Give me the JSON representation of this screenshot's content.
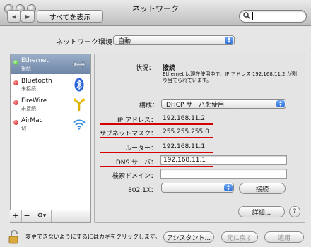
{
  "window": {
    "title": "ネットワーク"
  },
  "toolbar": {
    "back": "◀",
    "forward": "▶",
    "show_all": "すべてを表示",
    "search_value": ""
  },
  "location": {
    "label": "ネットワーク環境：",
    "value": "自動"
  },
  "services": [
    {
      "name": "Ethernet",
      "status": "接続",
      "state": "green",
      "icon": "ethernet-icon",
      "selected": true
    },
    {
      "name": "Bluetooth",
      "status": "未接続",
      "state": "red",
      "icon": "bluetooth-icon"
    },
    {
      "name": "FireWire",
      "status": "未接続",
      "state": "red",
      "icon": "firewire-icon"
    },
    {
      "name": "AirMac",
      "status": "切",
      "state": "red",
      "icon": "wifi-icon"
    }
  ],
  "sidebar_buttons": {
    "add": "+",
    "remove": "−",
    "gear": "⚙▾"
  },
  "details": {
    "status_label": "状況：",
    "status_value": "接続",
    "status_desc": "Ethernet は現在使用中で、IP アドレス 192.168.11.2 が割り当てられています。",
    "config_label": "構成：",
    "config_value": "DHCP サーバを使用",
    "ip_label": "IP アドレス：",
    "ip_value": "192.168.11.2",
    "subnet_label": "サブネットマスク：",
    "subnet_value": "255.255.255.0",
    "router_label": "ルーター：",
    "router_value": "192.168.11.1",
    "dns_label": "DNS サーバ：",
    "dns_value": "192.168.11.1",
    "search_domain_label": "検索ドメイン：",
    "search_domain_value": "",
    "dot1x_label": "802.1X：",
    "dot1x_value": "",
    "connect_button": "接続",
    "advanced_button": "詳細...",
    "help": "?"
  },
  "footer": {
    "lock_text": "変更できないようにするにはカギをクリックします。",
    "assistant_button": "アシスタント...",
    "revert_button": "元に戻す",
    "apply_button": "適用"
  },
  "colors": {
    "highlight_red": "#d40000",
    "selection": "#7b92b1",
    "accent_blue": "#2f6fd6"
  }
}
